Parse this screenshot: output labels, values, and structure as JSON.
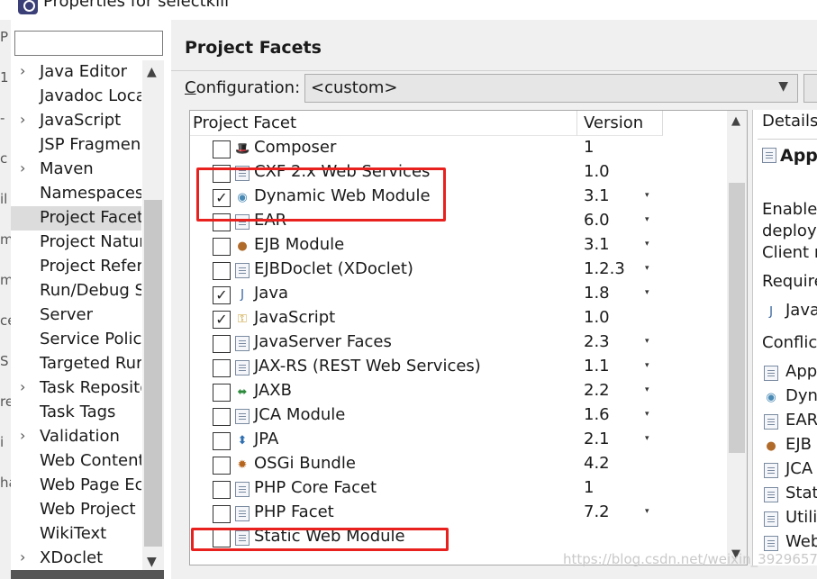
{
  "window": {
    "title": "Properties for selectkill"
  },
  "left_strip_glyphs": [
    "P",
    "1",
    "-",
    "c",
    "il",
    "m",
    "m",
    "ce",
    "S",
    "re",
    "i",
    "ha"
  ],
  "nav": {
    "filter_placeholder": "",
    "items": [
      {
        "label": "Java Editor",
        "arrow": true,
        "selected": false
      },
      {
        "label": "Javadoc Loca",
        "arrow": false,
        "selected": false
      },
      {
        "label": "JavaScript",
        "arrow": true,
        "selected": false
      },
      {
        "label": "JSP Fragmen",
        "arrow": false,
        "selected": false
      },
      {
        "label": "Maven",
        "arrow": true,
        "selected": false
      },
      {
        "label": "Namespaces",
        "arrow": false,
        "selected": false
      },
      {
        "label": "Project Facet",
        "arrow": false,
        "selected": true
      },
      {
        "label": "Project Natur",
        "arrow": false,
        "selected": false
      },
      {
        "label": "Project Refer",
        "arrow": false,
        "selected": false
      },
      {
        "label": "Run/Debug S",
        "arrow": false,
        "selected": false
      },
      {
        "label": "Server",
        "arrow": false,
        "selected": false
      },
      {
        "label": "Service Polici",
        "arrow": false,
        "selected": false
      },
      {
        "label": "Targeted Rur",
        "arrow": false,
        "selected": false
      },
      {
        "label": "Task Reposito",
        "arrow": true,
        "selected": false
      },
      {
        "label": "Task Tags",
        "arrow": false,
        "selected": false
      },
      {
        "label": "Validation",
        "arrow": true,
        "selected": false
      },
      {
        "label": "Web Content",
        "arrow": false,
        "selected": false
      },
      {
        "label": "Web Page Ec",
        "arrow": false,
        "selected": false
      },
      {
        "label": "Web Project",
        "arrow": false,
        "selected": false
      },
      {
        "label": "WikiText",
        "arrow": false,
        "selected": false
      },
      {
        "label": "XDoclet",
        "arrow": true,
        "selected": false
      }
    ]
  },
  "page": {
    "title": "Project Facets",
    "configuration_label_underlined": "C",
    "configuration_label_rest": "onfiguration:",
    "configuration_value": "<custom>"
  },
  "table": {
    "col_facet": "Project Facet",
    "col_version": "Version",
    "rows": [
      {
        "name": "Composer",
        "version": "1",
        "checked": false,
        "dropdown": false,
        "icon": "composer"
      },
      {
        "name": "CXF 2.x Web Services",
        "version": "1.0",
        "checked": false,
        "dropdown": false,
        "icon": "doc"
      },
      {
        "name": "Dynamic Web Module",
        "version": "3.1",
        "checked": true,
        "dropdown": true,
        "icon": "globe"
      },
      {
        "name": "EAR",
        "version": "6.0",
        "checked": false,
        "dropdown": true,
        "icon": "doc"
      },
      {
        "name": "EJB Module",
        "version": "3.1",
        "checked": false,
        "dropdown": true,
        "icon": "bean"
      },
      {
        "name": "EJBDoclet (XDoclet)",
        "version": "1.2.3",
        "checked": false,
        "dropdown": true,
        "icon": "doc"
      },
      {
        "name": "Java",
        "version": "1.8",
        "checked": true,
        "dropdown": true,
        "icon": "java"
      },
      {
        "name": "JavaScript",
        "version": "1.0",
        "checked": true,
        "dropdown": false,
        "icon": "js"
      },
      {
        "name": "JavaServer Faces",
        "version": "2.3",
        "checked": false,
        "dropdown": true,
        "icon": "doc"
      },
      {
        "name": "JAX-RS (REST Web Services)",
        "version": "1.1",
        "checked": false,
        "dropdown": true,
        "icon": "doc"
      },
      {
        "name": "JAXB",
        "version": "2.2",
        "checked": false,
        "dropdown": true,
        "icon": "jaxb"
      },
      {
        "name": "JCA Module",
        "version": "1.6",
        "checked": false,
        "dropdown": true,
        "icon": "doc"
      },
      {
        "name": "JPA",
        "version": "2.1",
        "checked": false,
        "dropdown": true,
        "icon": "jpa"
      },
      {
        "name": "OSGi Bundle",
        "version": "4.2",
        "checked": false,
        "dropdown": false,
        "icon": "osgi"
      },
      {
        "name": "PHP Core Facet",
        "version": "1",
        "checked": false,
        "dropdown": false,
        "icon": "doc"
      },
      {
        "name": "PHP Facet",
        "version": "7.2",
        "checked": false,
        "dropdown": true,
        "icon": "doc"
      },
      {
        "name": "Static Web Module",
        "version": "",
        "checked": false,
        "dropdown": false,
        "icon": "doc"
      }
    ]
  },
  "details": {
    "tab": "Details",
    "title": "Appl",
    "description_lines": [
      "Enables",
      "deploy",
      "Client m"
    ],
    "requires_label": "Require",
    "requires_items": [
      {
        "label": "Java",
        "icon": "java"
      }
    ],
    "conflicts_label": "Conflict",
    "conflicts_items": [
      {
        "label": "App",
        "icon": "doc"
      },
      {
        "label": "Dyn",
        "icon": "globe"
      },
      {
        "label": "EAR",
        "icon": "doc"
      },
      {
        "label": "EJB I",
        "icon": "bean"
      },
      {
        "label": "JCA",
        "icon": "doc"
      },
      {
        "label": "Stat",
        "icon": "doc"
      },
      {
        "label": "Utili",
        "icon": "doc"
      },
      {
        "label": "Web",
        "icon": "doc"
      }
    ]
  },
  "annotation_color": "#e8211e",
  "watermark": "https://blog.csdn.net/weixin_39296576"
}
